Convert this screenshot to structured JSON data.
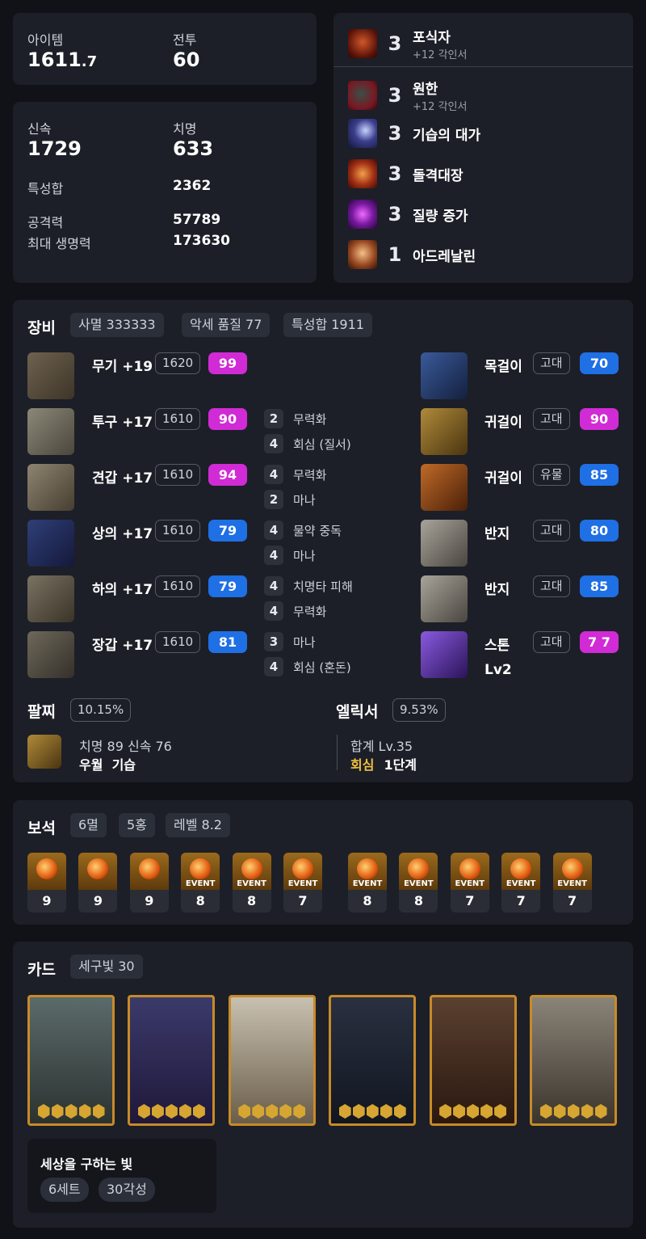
{
  "summary": {
    "item_label": "아이템",
    "item_value_main": "1611",
    "item_value_decimal": ".7",
    "combat_label": "전투",
    "combat_value": "60"
  },
  "stats": {
    "swift_label": "신속",
    "swift_value": "1729",
    "crit_label": "치명",
    "crit_value": "633",
    "trait_label": "특성합",
    "trait_value": "2362",
    "atk_label": "공격력",
    "atk_value": "57789",
    "hp_label": "최대 생명력",
    "hp_value": "173630"
  },
  "engravings": [
    {
      "level": "3",
      "name": "포식자",
      "sub": "+12 각인서",
      "icon": "predator-icon"
    },
    {
      "level": "3",
      "name": "원한",
      "sub": "+12 각인서",
      "icon": "grudge-icon"
    },
    {
      "level": "3",
      "name": "기습의 대가",
      "sub": "",
      "icon": "ambush-icon"
    },
    {
      "level": "3",
      "name": "돌격대장",
      "sub": "",
      "icon": "vanguard-icon"
    },
    {
      "level": "3",
      "name": "질량 증가",
      "sub": "",
      "icon": "mass-increase-icon"
    },
    {
      "level": "1",
      "name": "아드레날린",
      "sub": "",
      "icon": "adrenaline-icon"
    }
  ],
  "equipment": {
    "title": "장비",
    "tags": [
      "사멸 333333",
      "악세 품질 77",
      "특성합 1911"
    ],
    "gear": [
      {
        "name": "무기 +19",
        "ilvl": "1620",
        "quality": "99",
        "qcolor": "#d12bd6",
        "abilities": []
      },
      {
        "name": "투구 +17",
        "ilvl": "1610",
        "quality": "90",
        "qcolor": "#d12bd6",
        "abilities": [
          {
            "n": "2",
            "t": "무력화"
          },
          {
            "n": "4",
            "t": "회심 (질서)"
          }
        ]
      },
      {
        "name": "견갑 +17",
        "ilvl": "1610",
        "quality": "94",
        "qcolor": "#d12bd6",
        "abilities": [
          {
            "n": "4",
            "t": "무력화"
          },
          {
            "n": "2",
            "t": "마나"
          }
        ]
      },
      {
        "name": "상의 +17",
        "ilvl": "1610",
        "quality": "79",
        "qcolor": "#1f6fe5",
        "abilities": [
          {
            "n": "4",
            "t": "물약 중독"
          },
          {
            "n": "4",
            "t": "마나"
          }
        ]
      },
      {
        "name": "하의 +17",
        "ilvl": "1610",
        "quality": "79",
        "qcolor": "#1f6fe5",
        "abilities": [
          {
            "n": "4",
            "t": "치명타 피해"
          },
          {
            "n": "4",
            "t": "무력화"
          }
        ]
      },
      {
        "name": "장갑 +17",
        "ilvl": "1610",
        "quality": "81",
        "qcolor": "#1f6fe5",
        "abilities": [
          {
            "n": "3",
            "t": "마나"
          },
          {
            "n": "4",
            "t": "회심 (혼돈)"
          }
        ]
      }
    ],
    "accessories": [
      {
        "name": "목걸이",
        "grade": "고대",
        "quality": "70",
        "qcolor": "#1f6fe5",
        "extra": ""
      },
      {
        "name": "귀걸이",
        "grade": "고대",
        "quality": "90",
        "qcolor": "#d12bd6",
        "extra": ""
      },
      {
        "name": "귀걸이",
        "grade": "유물",
        "quality": "85",
        "qcolor": "#1f6fe5",
        "extra": ""
      },
      {
        "name": "반지",
        "grade": "고대",
        "quality": "80",
        "qcolor": "#1f6fe5",
        "extra": ""
      },
      {
        "name": "반지",
        "grade": "고대",
        "quality": "85",
        "qcolor": "#1f6fe5",
        "extra": ""
      },
      {
        "name": "스톤",
        "grade": "고대",
        "quality": "7 7",
        "qcolor": "#d12bd6",
        "extra": "Lv2"
      }
    ],
    "bracelet": {
      "title": "팔찌",
      "pct": "10.15%",
      "line1": "치명 89  신속 76",
      "line2": "우월  기습"
    },
    "elixir": {
      "title": "엘릭서",
      "pct": "9.53%",
      "line1": "합계 Lv.35",
      "line2_a": "회심",
      "line2_b": "1단계"
    }
  },
  "gems": {
    "title": "보석",
    "tags": [
      "6멸",
      "5홍",
      "레벨 8.2"
    ],
    "event_label": "EVENT",
    "group1": [
      {
        "lv": "9",
        "event": false
      },
      {
        "lv": "9",
        "event": false
      },
      {
        "lv": "9",
        "event": false
      },
      {
        "lv": "8",
        "event": true
      },
      {
        "lv": "8",
        "event": true
      },
      {
        "lv": "7",
        "event": true
      }
    ],
    "group2": [
      {
        "lv": "8",
        "event": true
      },
      {
        "lv": "8",
        "event": true
      },
      {
        "lv": "7",
        "event": true
      },
      {
        "lv": "7",
        "event": true
      },
      {
        "lv": "7",
        "event": true
      }
    ]
  },
  "cards": {
    "title": "카드",
    "tag": "세구빛 30",
    "awaken_stars": 5,
    "count": 6,
    "set_name": "세상을 구하는 빛",
    "set_tags": [
      "6세트",
      "30각성"
    ]
  }
}
